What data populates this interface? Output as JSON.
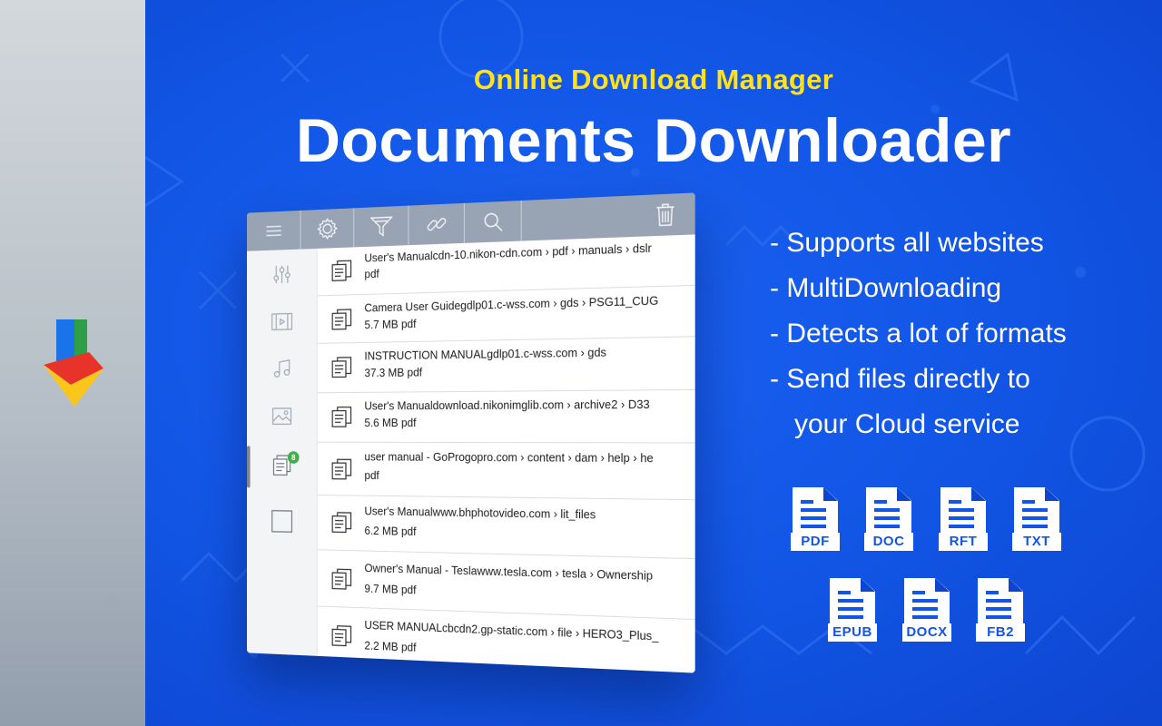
{
  "header": {
    "subtitle": "Online Download Manager",
    "title": "Documents Downloader"
  },
  "features": [
    "- Supports all websites",
    "- MultiDownloading",
    "- Detects a lot of formats",
    "- Send files directly to",
    "your Cloud service"
  ],
  "formats": [
    "PDF",
    "DOC",
    "RFT",
    "TXT",
    "EPUB",
    "DOCX",
    "FB2"
  ],
  "toolbar": {
    "buttons": [
      "menu-icon",
      "gear-icon",
      "filter-icon",
      "link-icon",
      "search-icon",
      "trash-icon"
    ]
  },
  "sidebar": {
    "items": [
      "equalizer-icon",
      "video-icon",
      "music-icon",
      "image-icon",
      "documents-icon",
      "blank-square-icon"
    ],
    "documents_badge": "8"
  },
  "downloads": [
    {
      "title": "User's Manualcdn-10.nikon-cdn.com › pdf › manuals › dslr",
      "sub": "pdf"
    },
    {
      "title": "Camera User Guidegdlp01.c-wss.com › gds › PSG11_CUG",
      "sub": "5.7 MB pdf"
    },
    {
      "title": "INSTRUCTION MANUALgdlp01.c-wss.com › gds",
      "sub": "37.3 MB pdf"
    },
    {
      "title": "User's Manualdownload.nikonimglib.com › archive2 › D33",
      "sub": "5.6 MB pdf"
    },
    {
      "title": "user manual - GoProgopro.com › content › dam › help › he",
      "sub": "pdf"
    },
    {
      "title": "User's Manualwww.bhphotovideo.com › lit_files",
      "sub": "6.2 MB pdf"
    },
    {
      "title": "Owner's Manual - Teslawww.tesla.com › tesla › Ownership",
      "sub": "9.7 MB pdf"
    },
    {
      "title": "USER MANUALcbcdn2.gp-static.com › file › HERO3_Plus_",
      "sub": "2.2 MB pdf"
    }
  ],
  "colors": {
    "background_blue": "#1355e8",
    "subtitle_yellow": "#ffe21a",
    "toolbar_gray": "#98a4b4",
    "badge_green": "#3fae4a"
  }
}
